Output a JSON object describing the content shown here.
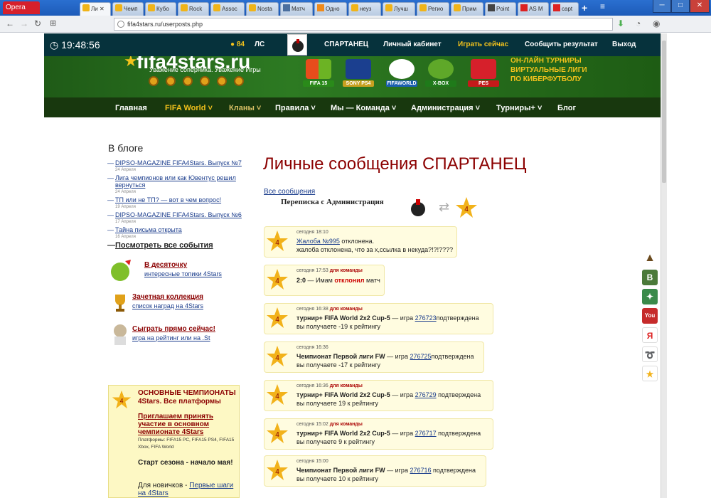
{
  "browser": {
    "opera_label": "Opera",
    "tabs": [
      {
        "label": "Ли",
        "icon": "star-favicon",
        "active": true
      },
      {
        "label": "Чемп",
        "icon": "star-favicon"
      },
      {
        "label": "Кубо",
        "icon": "star-favicon"
      },
      {
        "label": "Rock",
        "icon": "star-favicon"
      },
      {
        "label": "Assoc",
        "icon": "star-favicon"
      },
      {
        "label": "Nosta",
        "icon": "star-favicon"
      },
      {
        "label": "Матч",
        "icon": "b-favicon"
      },
      {
        "label": "Одно",
        "icon": "ok-favicon"
      },
      {
        "label": "неуз",
        "icon": "star-favicon"
      },
      {
        "label": "Лучш",
        "icon": "star-favicon"
      },
      {
        "label": "Регио",
        "icon": "star-favicon"
      },
      {
        "label": "Прим",
        "icon": "star-favicon"
      },
      {
        "label": "Point",
        "icon": "m-favicon"
      },
      {
        "label": "AS M",
        "icon": "as-favicon"
      },
      {
        "label": "capt",
        "icon": "youtube-favicon"
      }
    ],
    "new_tab": "+",
    "url": "fifa4stars.ru/userposts.php"
  },
  "site": {
    "clock": "19:48:56",
    "coins": "84",
    "ls": "ЛС",
    "top_menu": [
      "СПАРТАНЕЦ",
      "Личный кабинет",
      "Играть сейчас",
      "Сообщить результат",
      "Выход"
    ],
    "logo": "fifa4stars.ru",
    "slogan": "Уважение соперника. Уважение Игры",
    "platforms": [
      "FIFA 15",
      "SONY PS4",
      "FIFAWORLD",
      "X-BOX",
      "PES"
    ],
    "promo": [
      "ОН-ЛАЙН ТУРНИРЫ",
      "ВИРТУАЛЬНЫЕ ЛИГИ",
      "ПО КИБЕРФУТБОЛУ"
    ],
    "main_menu": [
      "Главная",
      "FIFA World",
      "Кланы",
      "Правила",
      "Мы — Команда",
      "Администрация",
      "Турниры+",
      "Блог"
    ]
  },
  "sidebar": {
    "heading": "В блоге",
    "posts": [
      {
        "title": "DIPSO-MAGAZINE FIFA4Stars. Выпуск №7",
        "date": "24 Апреля"
      },
      {
        "title": "Лига чемпионов или как Ювентус решил вернуться",
        "date": "24 Апреля"
      },
      {
        "title": "ТП или не ТП? — вот в чем вопрос!",
        "date": "19 Апреля"
      },
      {
        "title": "DIPSO-MAGAZINE FIFA4Stars. Выпуск №6",
        "date": "17 Апреля"
      },
      {
        "title": "Тайна письма открыта",
        "date": "16 Апреля"
      }
    ],
    "see_all": "Посмотреть все события",
    "promos": [
      {
        "title": "В десяточку",
        "sub": "интересные топики 4Stars"
      },
      {
        "title": "Зачетная коллекция",
        "sub": "список наград на 4Stars"
      },
      {
        "title": "Сыграть прямо сейчас!",
        "sub": "игра на рейтинг или на .St"
      }
    ],
    "box": {
      "heading": "ОСНОВНЫЕ ЧЕМПИОНАТЫ 4Stars. Все платформы",
      "link": "Приглашаем принять участие в основном чемпионате 4Stars",
      "platforms": "Платформы: FIFA15 PC, FIFA15 PS4, FIFA15 Xbox, FIFA World",
      "season": "Старт сезона - начало мая!",
      "newbies_prefix": "Для новичков - ",
      "newbies_link": "Первые шаги на 4Stars"
    }
  },
  "main": {
    "title": "Личные сообщения СПАРТАНЕЦ",
    "all_messages": "Все сообщения",
    "correspondence": "Переписка с Администрация",
    "messages": [
      {
        "time": "сегодня 18:10",
        "team": "",
        "line1_link": "Жалоба №995",
        "line1_rest": " отклонена.",
        "line2": "жалоба отклонена, что за х,ссылка в некуда?!?!????"
      },
      {
        "time": "сегодня 17:53",
        "team": "для команды",
        "line1_bold": "2:0",
        "line1_mid": " — Имам ",
        "line1_red": "отклонил",
        "line1_rest": " матч",
        "line2": ""
      },
      {
        "time": "сегодня 16:38",
        "team": "для команды",
        "line1_bold": "турнир+ FIFA World 2x2 Cup-5",
        "line1_mid": " — игра ",
        "line1_link": "276723",
        "line1_rest": "подтверждена",
        "line2": "вы получаете -19 к рейтингу"
      },
      {
        "time": "сегодня 16:36",
        "team": "",
        "line1_bold": "Чемпионат Первой лиги FW",
        "line1_mid": " — игра ",
        "line1_link": "276725",
        "line1_rest": "подтверждена",
        "line2": "вы получаете -17 к рейтингу"
      },
      {
        "time": "сегодня 16:36",
        "team": "для команды",
        "line1_bold": "турнир+ FIFA World 2x2 Cup-5",
        "line1_mid": " — игра ",
        "line1_link": "276729",
        "line1_rest": " подтверждена",
        "line2": "вы получаете 19 к рейтингу"
      },
      {
        "time": "сегодня 15:02",
        "team": "для команды",
        "line1_bold": "турнир+ FIFA World 2x2 Cup-5",
        "line1_mid": " — игра ",
        "line1_link": "276717",
        "line1_rest": " подтверждена",
        "line2": "вы получаете 9 к рейтингу"
      },
      {
        "time": "сегодня 15:00",
        "team": "",
        "line1_bold": "Чемпионат Первой лиги FW",
        "line1_mid": " — игра ",
        "line1_link": "276716",
        "line1_rest": " подтверждена",
        "line2": "вы получаете 10 к рейтингу"
      }
    ]
  },
  "social": [
    "army-hat-icon",
    "vk-icon",
    "twitter-icon",
    "youtube-icon",
    "yandex-icon",
    "ribbon-icon",
    "star-icon"
  ],
  "colors": {
    "accent": "#8b0000",
    "menu_bg": "#06323c",
    "gold": "#f3c21c",
    "msg_bg": "#fffce0"
  }
}
